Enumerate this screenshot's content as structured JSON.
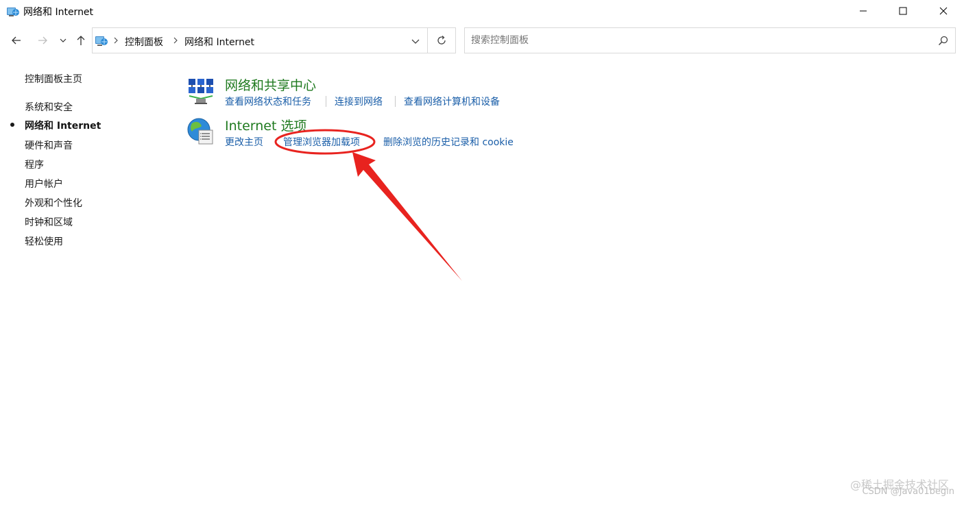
{
  "window": {
    "title": "网络和 Internet",
    "icon": "network-folder-icon"
  },
  "address": {
    "crumbs": [
      "控制面板",
      "网络和 Internet"
    ]
  },
  "search": {
    "placeholder": "搜索控制面板"
  },
  "sidebar": {
    "items": [
      {
        "label": "控制面板主页",
        "active": false
      },
      {
        "label": "系统和安全",
        "active": false
      },
      {
        "label": "网络和 Internet",
        "active": true
      },
      {
        "label": "硬件和声音",
        "active": false
      },
      {
        "label": "程序",
        "active": false
      },
      {
        "label": "用户帐户",
        "active": false
      },
      {
        "label": "外观和个性化",
        "active": false
      },
      {
        "label": "时钟和区域",
        "active": false
      },
      {
        "label": "轻松使用",
        "active": false
      }
    ]
  },
  "categories": [
    {
      "title": "网络和共享中心",
      "icon": "network-sharing-center-icon",
      "links": [
        "查看网络状态和任务",
        "连接到网络",
        "查看网络计算机和设备"
      ]
    },
    {
      "title": "Internet 选项",
      "icon": "internet-options-globe-icon",
      "links": [
        "更改主页",
        "管理浏览器加载项",
        "删除浏览的历史记录和 cookie"
      ]
    }
  ],
  "colors": {
    "category_title": "#1f7a1f",
    "link": "#1a5ea8",
    "annotation": "#e8231f"
  },
  "watermark": {
    "line1": "@稀土掘金技术社区",
    "line2": "CSDN @Java01begin"
  }
}
